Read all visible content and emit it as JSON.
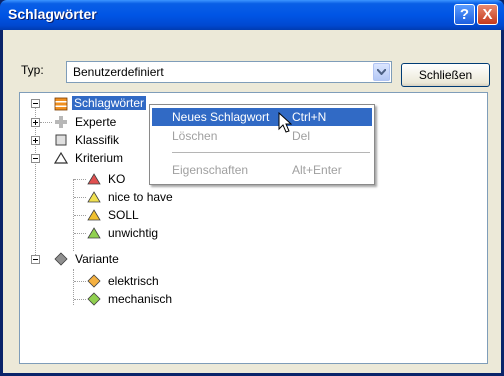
{
  "window": {
    "title": "Schlagwörter"
  },
  "type_field": {
    "label": "Typ:",
    "value": "Benutzerdefiniert"
  },
  "buttons": {
    "close": "Schließen",
    "help": "?",
    "title_close": "X"
  },
  "tree": {
    "root": "Schlagwörter",
    "items": [
      {
        "label": "Experte",
        "icon": "plus-gray-icon"
      },
      {
        "label": "Klassifik",
        "icon": "gray-square-icon"
      },
      {
        "label": "Kriterium",
        "icon": "triangle-outline-icon"
      },
      {
        "label": "KO",
        "icon": "red-triangle-icon",
        "color": "#e05050"
      },
      {
        "label": "nice to have",
        "icon": "yellow-triangle-icon",
        "color": "#f0e050"
      },
      {
        "label": "SOLL",
        "icon": "orange-triangle-icon",
        "color": "#f0c030"
      },
      {
        "label": "unwichtig",
        "icon": "green-triangle-icon",
        "color": "#90d050"
      },
      {
        "label": "Variante",
        "icon": "gray-diamond-icon",
        "color": "#909090"
      },
      {
        "label": "elektrisch",
        "icon": "orange-diamond-icon",
        "color": "#f4b040"
      },
      {
        "label": "mechanisch",
        "icon": "green-diamond-icon",
        "color": "#90d050"
      }
    ]
  },
  "context_menu": {
    "items": [
      {
        "label": "Neues Schlagwort",
        "shortcut": "Ctrl+N",
        "state": "highlighted"
      },
      {
        "label": "Löschen",
        "shortcut": "Del",
        "state": "disabled"
      },
      {
        "label": "Eigenschaften",
        "shortcut": "Alt+Enter",
        "state": "disabled"
      }
    ]
  },
  "colors": {
    "selection": "#316ac5",
    "titlebar": "#0055e5",
    "dialog": "#ece9d8"
  }
}
